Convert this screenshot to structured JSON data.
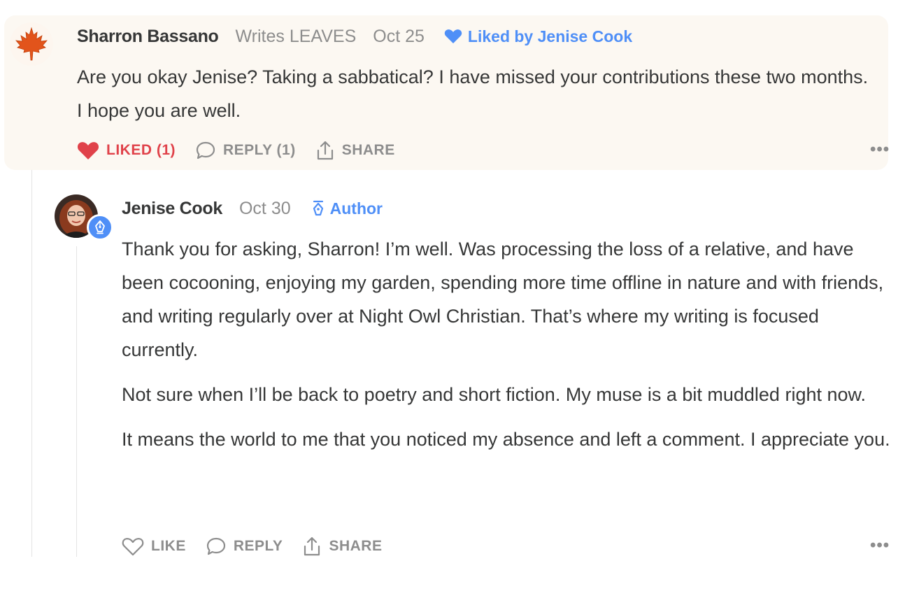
{
  "colors": {
    "accent": "#4f8ff7",
    "liked": "#e0424a",
    "highlight_bg": "#fcf8f2",
    "muted": "#8d8d8d",
    "text": "#363737"
  },
  "comments": [
    {
      "author": "Sharron Bassano",
      "writes": "Writes LEAVES",
      "date": "Oct 25",
      "liked_by": "Liked by Jenise Cook",
      "avatar_icon": "maple-leaf-icon",
      "body": [
        "Are you okay Jenise? Taking a sabbatical? I have missed your contributions these two months. I hope you are well."
      ],
      "actions": {
        "like": "LIKED (1)",
        "reply": "REPLY (1)",
        "share": "SHARE"
      },
      "more": "•••"
    },
    {
      "author": "Jenise Cook",
      "date": "Oct 30",
      "author_tag": "Author",
      "badge_icon": "pen-nib-icon",
      "body": [
        "Thank you for asking, Sharron! I’m well. Was processing the loss of a relative, and have been cocooning, enjoying my garden, spending more time offline in nature and with friends, and writing regularly over at Night Owl Christian. That’s where my writing is focused currently.",
        "Not sure when I’ll be back to poetry and short fiction. My muse is a bit muddled right now.",
        "It means the world to me that you noticed my absence and left a comment. I appreciate you."
      ],
      "actions": {
        "like": "LIKE",
        "reply": "REPLY",
        "share": "SHARE"
      },
      "more": "•••"
    }
  ]
}
